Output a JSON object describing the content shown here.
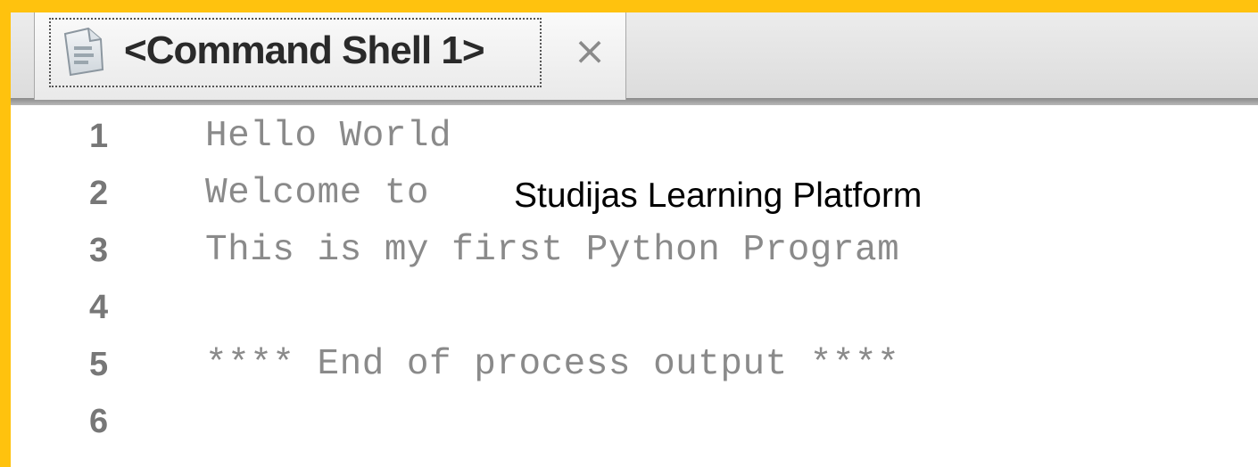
{
  "tab": {
    "label": "<Command Shell 1>",
    "close_glyph": "×",
    "icon": "shell-page-icon"
  },
  "lines": [
    {
      "number": "1",
      "text": "Hello World"
    },
    {
      "number": "2",
      "text": "Welcome to "
    },
    {
      "number": "3",
      "text": "This is my first Python Program"
    },
    {
      "number": "4",
      "text": ""
    },
    {
      "number": "5",
      "text": "**** End of process output ****"
    },
    {
      "number": "6",
      "text": ""
    }
  ],
  "overlay": {
    "text": "Studijas Learning Platform"
  },
  "colors": {
    "border": "#ffc20e",
    "code_text": "#8a8a8a",
    "line_number": "#777777"
  }
}
